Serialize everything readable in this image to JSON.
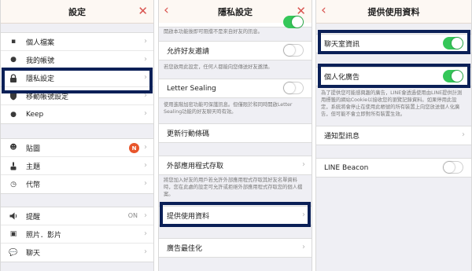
{
  "colors": {
    "accent": "#d9534f",
    "toggle_on": "#35c759",
    "highlight": "#0b2057",
    "badge": "#e8552b"
  },
  "settings_panel": {
    "title": "設定",
    "group1": [
      {
        "label": "個人檔案",
        "icon": "person-card-icon",
        "glyph": "👤"
      },
      {
        "label": "我的帳號",
        "icon": "person-icon",
        "glyph": "●"
      },
      {
        "label": "隱私設定",
        "icon": "lock-icon",
        "glyph": "🔒"
      },
      {
        "label": "移動帳號設定",
        "icon": "shield-icon",
        "glyph": "⛨"
      },
      {
        "label": "Keep",
        "icon": "keep-icon",
        "glyph": "●"
      }
    ],
    "group2": [
      {
        "label": "貼圖",
        "icon": "smiley-icon",
        "glyph": "☺",
        "badge": "N"
      },
      {
        "label": "主題",
        "icon": "brush-icon",
        "glyph": "▲"
      },
      {
        "label": "代幣",
        "icon": "clock-icon",
        "glyph": "◷"
      }
    ],
    "group3": [
      {
        "label": "提醒",
        "icon": "speaker-icon",
        "glyph": "◀",
        "value": "ON"
      },
      {
        "label": "照片．影片",
        "icon": "photo-icon",
        "glyph": "▣"
      },
      {
        "label": "聊天",
        "icon": "chat-bubble-icon",
        "glyph": "●"
      }
    ]
  },
  "privacy_panel": {
    "title": "隱私設定",
    "top_note": "開啟本功能後即可阻擋不是來自好友的訊息。",
    "allow_friend_invite": "允許好友邀請",
    "allow_friend_invite_note": "若您啟用此設定，任何人都能向您傳送好友邀請。",
    "letter_sealing": "Letter Sealing",
    "letter_sealing_note": "使用進階加密功能可保護訊息。但僅限於和同時開啟Letter Sealing功能的好友聊天時有效。",
    "update_qr": "更新行動條碼",
    "external_apps": "外部應用程式存取",
    "external_apps_note": "將您加入好友的用戶若允許外部應用程式存取其好友名單資料時，您在此處的設定可允許或拒絕外部應用程式存取您的個人檔案。",
    "provide_usage": "提供使用資料",
    "ad_optimization": "廣告最佳化"
  },
  "usage_panel": {
    "title": "提供使用資料",
    "chat_info": "聊天室資訊",
    "personalized_ads": "個人化廣告",
    "personalized_ads_note": "為了提供您可能感興趣的廣告，LINE會透過使用由LINE提供計測用標籤的網站Cookie以接收您的瀏覽記錄資料。如果停用此設定，系統將會停止在使用此帳號的所有裝置上向您放送個人化廣告，但可能不會立即對所有裝置生效。",
    "notification_messages": "通知型訊息",
    "line_beacon": "LINE Beacon"
  }
}
